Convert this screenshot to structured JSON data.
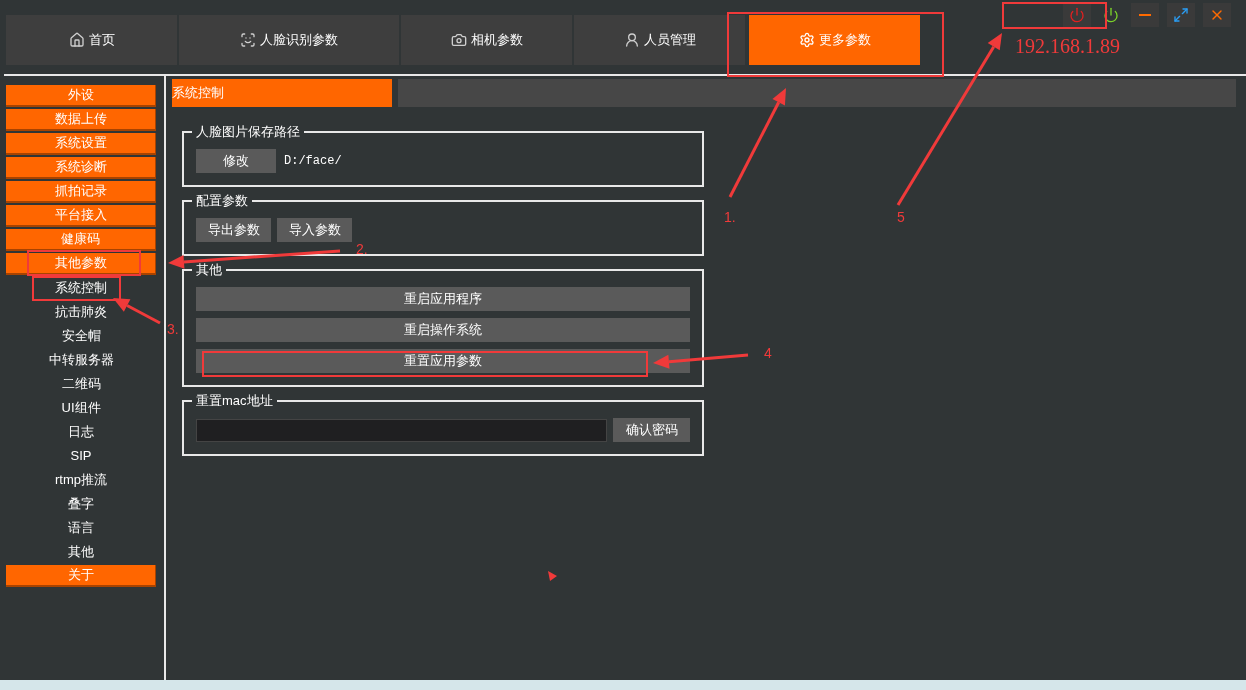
{
  "tabs": [
    {
      "label": "首页",
      "selected": false
    },
    {
      "label": "人脸识别参数",
      "selected": false
    },
    {
      "label": "相机参数",
      "selected": false
    },
    {
      "label": "人员管理",
      "selected": false
    },
    {
      "label": "更多参数",
      "selected": true
    }
  ],
  "sidebar": {
    "items": [
      {
        "label": "外设",
        "kind": "group"
      },
      {
        "label": "数据上传",
        "kind": "group"
      },
      {
        "label": "系统设置",
        "kind": "group"
      },
      {
        "label": "系统诊断",
        "kind": "group"
      },
      {
        "label": "抓拍记录",
        "kind": "group"
      },
      {
        "label": "平台接入",
        "kind": "group"
      },
      {
        "label": "健康码",
        "kind": "group"
      },
      {
        "label": "其他参数",
        "kind": "group",
        "children": [
          {
            "label": "系统控制"
          },
          {
            "label": "抗击肺炎"
          },
          {
            "label": "安全帽"
          },
          {
            "label": "中转服务器"
          },
          {
            "label": "二维码"
          },
          {
            "label": "UI组件"
          },
          {
            "label": "日志"
          },
          {
            "label": "SIP"
          },
          {
            "label": "rtmp推流"
          },
          {
            "label": "叠字"
          },
          {
            "label": "语言"
          },
          {
            "label": "其他"
          }
        ]
      },
      {
        "label": "关于",
        "kind": "group"
      }
    ]
  },
  "page_title": "系统控制",
  "sections": [
    {
      "title": "人脸图片保存路径",
      "kind": "path",
      "button": "修改",
      "value": "D:/face/"
    },
    {
      "title": "配置参数",
      "kind": "buttons",
      "buttons": [
        "导出参数",
        "导入参数"
      ]
    },
    {
      "title": "其他",
      "kind": "stack",
      "buttons": [
        "重启应用程序",
        "重启操作系统",
        "重置应用参数"
      ]
    },
    {
      "title": "重置mac地址",
      "kind": "password",
      "button": "确认密码"
    }
  ],
  "annotations": [
    {
      "label": "1."
    },
    {
      "label": "2."
    },
    {
      "label": "3."
    },
    {
      "label": "4"
    },
    {
      "label": "5"
    },
    {
      "label": "192.168.1.89"
    }
  ]
}
